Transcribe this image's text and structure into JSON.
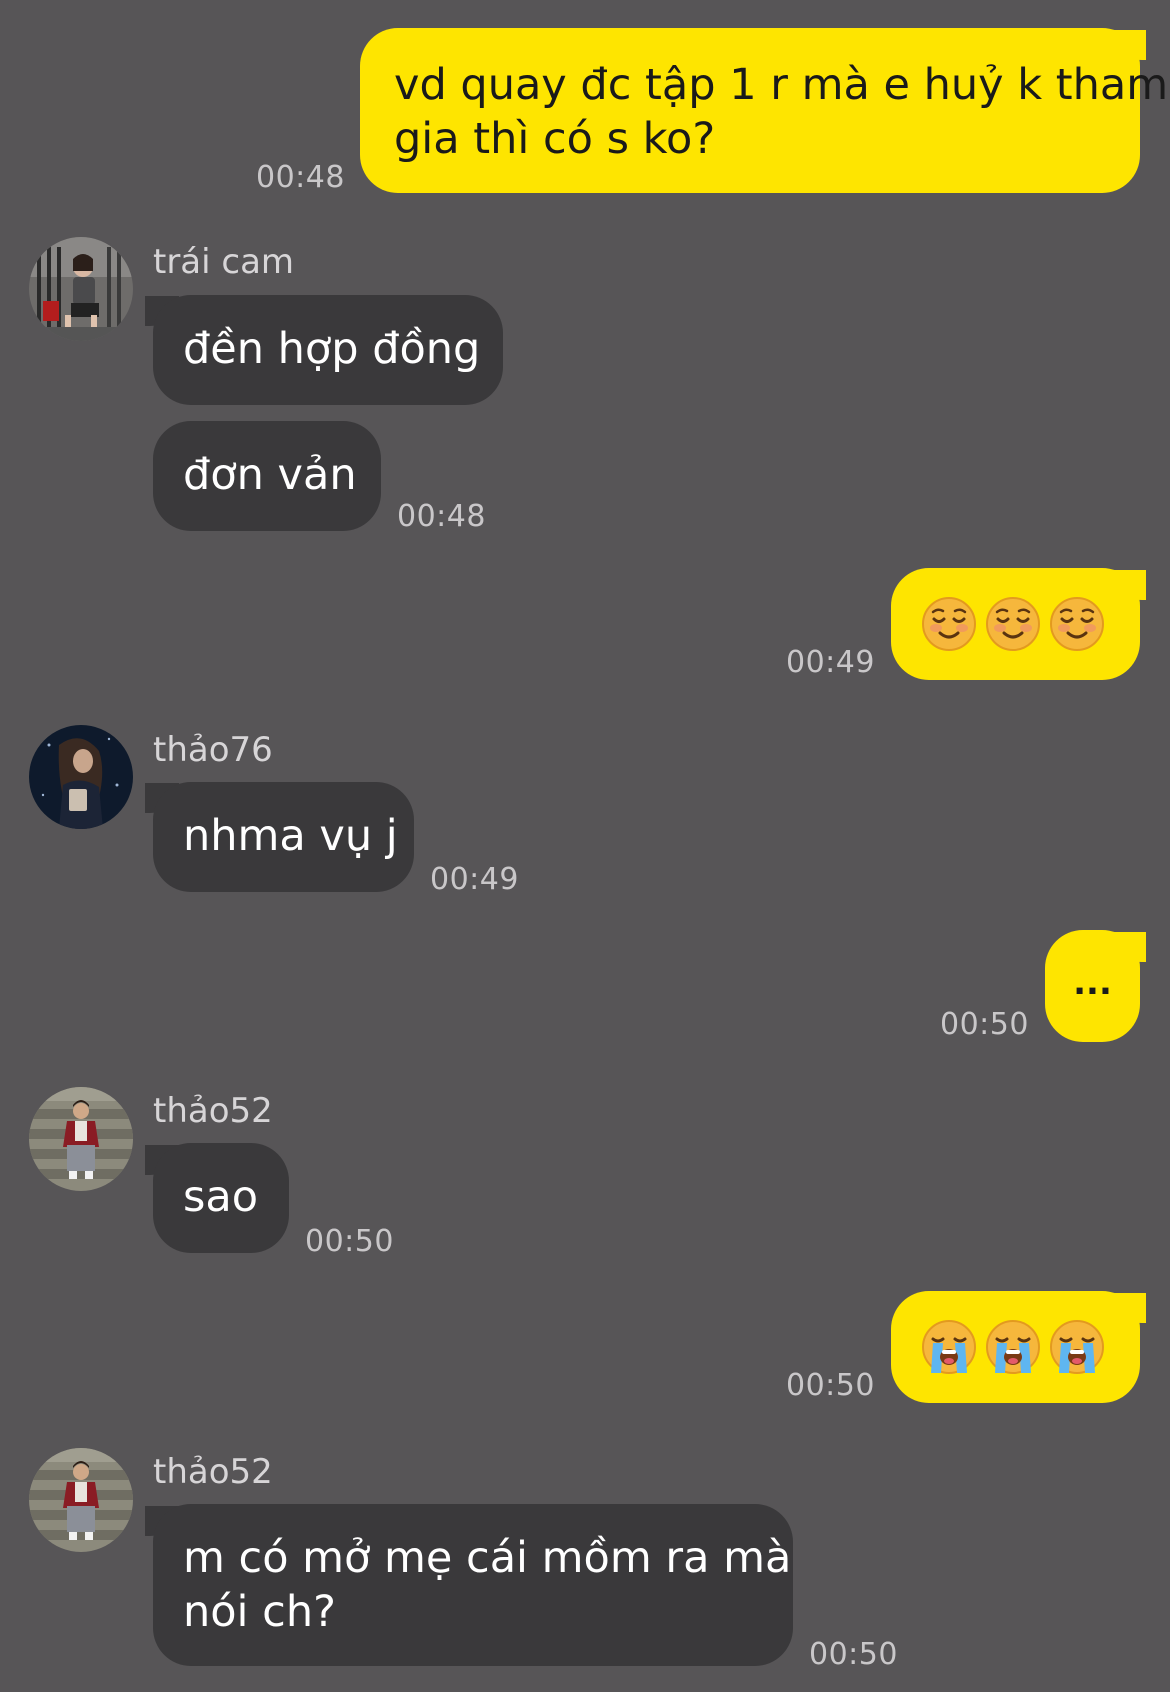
{
  "messages": [
    {
      "from": "me",
      "text": "vd quay đc tập 1 r mà e huỷ k tham",
      "text2": "gia thì có s ko?",
      "time": "00:48"
    },
    {
      "from": "trái cam",
      "name": "trái cam",
      "texts": [
        "đền hợp đồng",
        "đơn vản"
      ],
      "time": "00:48",
      "avatar": "avatar-traicam"
    },
    {
      "from": "me",
      "emoji": "relieved-smile-emoji",
      "count": 3,
      "time": "00:49"
    },
    {
      "from": "thảo76",
      "name": "thảo76",
      "texts": [
        "nhma vụ j"
      ],
      "time": "00:49",
      "avatar": "avatar-thao76"
    },
    {
      "from": "me",
      "text": "...",
      "time": "00:50"
    },
    {
      "from": "thảo52",
      "name": "thảo52",
      "texts": [
        "sao"
      ],
      "time": "00:50",
      "avatar": "avatar-thao52"
    },
    {
      "from": "me",
      "emoji": "loudly-crying-emoji",
      "count": 3,
      "time": "00:50"
    },
    {
      "from": "thảo52",
      "name": "thảo52",
      "text": "m có mở mẹ cái mồm ra mà",
      "text2": "nói ch?",
      "time": "00:50",
      "avatar": "avatar-thao52"
    }
  ],
  "colors": {
    "background": "#575557",
    "outgoing_bubble": "#fee500",
    "incoming_bubble": "#3a393b",
    "timestamp": "#c9c7c9"
  }
}
